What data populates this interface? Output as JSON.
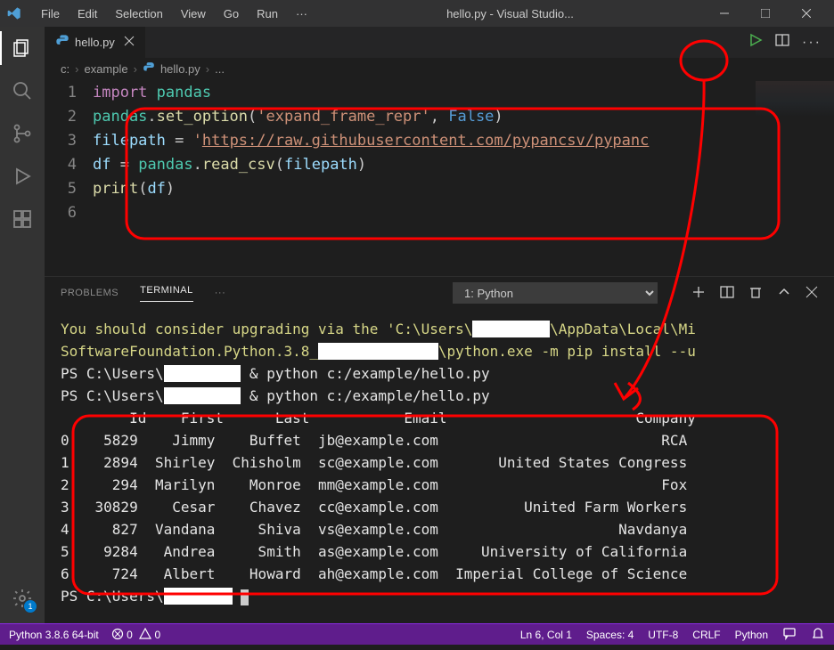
{
  "titlebar": {
    "menus": [
      "File",
      "Edit",
      "Selection",
      "View",
      "Go",
      "Run",
      "···"
    ],
    "title": "hello.py - Visual Studio..."
  },
  "tab": {
    "filename": "hello.py"
  },
  "breadcrumb": {
    "parts": [
      "c:",
      "example",
      "hello.py",
      "..."
    ]
  },
  "code": {
    "lines": [
      {
        "n": "1",
        "tokens": [
          [
            "tk-kw",
            "import"
          ],
          [
            "",
            " "
          ],
          [
            "tk-mod",
            "pandas"
          ]
        ]
      },
      {
        "n": "2",
        "tokens": [
          [
            "tk-mod",
            "pandas"
          ],
          [
            "",
            "."
          ],
          [
            "tk-fn",
            "set_option"
          ],
          [
            "",
            "("
          ],
          [
            "tk-str",
            "'expand_frame_repr'"
          ],
          [
            "",
            ", "
          ],
          [
            "tk-const",
            "False"
          ],
          [
            "",
            ")"
          ]
        ]
      },
      {
        "n": "3",
        "tokens": [
          [
            "tk-var",
            "filepath"
          ],
          [
            "",
            " = "
          ],
          [
            "tk-str",
            "'"
          ],
          [
            "tk-url",
            "https://raw.githubusercontent.com/pypancsv/pypanc"
          ]
        ]
      },
      {
        "n": "4",
        "tokens": [
          [
            "tk-var",
            "df"
          ],
          [
            "",
            " = "
          ],
          [
            "tk-mod",
            "pandas"
          ],
          [
            "",
            "."
          ],
          [
            "tk-fn",
            "read_csv"
          ],
          [
            "",
            "("
          ],
          [
            "tk-var",
            "filepath"
          ],
          [
            "",
            ")"
          ]
        ]
      },
      {
        "n": "5",
        "tokens": [
          [
            "tk-fn",
            "print"
          ],
          [
            "",
            "("
          ],
          [
            "tk-var",
            "df"
          ],
          [
            "",
            ")"
          ]
        ]
      },
      {
        "n": "6",
        "tokens": []
      }
    ]
  },
  "panel": {
    "tabs": [
      "PROBLEMS",
      "TERMINAL",
      "···"
    ],
    "active": 1,
    "select": "1: Python"
  },
  "terminal": {
    "upgrade1": "You should consider upgrading via the 'C:\\Users\\",
    "upgrade1b": "\\AppData\\Local\\Mi",
    "upgrade2": "SoftwareFoundation.Python.3.8_",
    "upgrade2b": "\\python.exe -m pip install --u",
    "ps1a": "PS C:\\Users\\",
    "ps1b": " & python c:/example/hello.py",
    "ps2a": "PS C:\\Users\\",
    "ps2b": " & python c:/example/hello.py",
    "header": "        Id    First      Last           Email                      Company",
    "rows": [
      "0    5829    Jimmy    Buffet  jb@example.com                          RCA",
      "1    2894  Shirley  Chisholm  sc@example.com       United States Congress",
      "2     294  Marilyn    Monroe  mm@example.com                          Fox",
      "3   30829    Cesar    Chavez  cc@example.com          United Farm Workers",
      "4     827  Vandana     Shiva  vs@example.com                     Navdanya",
      "5    9284   Andrea     Smith  as@example.com     University of California",
      "6     724   Albert    Howard  ah@example.com  Imperial College of Science"
    ],
    "ps3": "PS C:\\Users\\"
  },
  "statusbar": {
    "python": "Python 3.8.6 64-bit",
    "errors": "0",
    "warnings": "0",
    "lncol": "Ln 6, Col 1",
    "spaces": "Spaces: 4",
    "encoding": "UTF-8",
    "eol": "CRLF",
    "lang": "Python"
  },
  "badges": {
    "settings": "1"
  }
}
